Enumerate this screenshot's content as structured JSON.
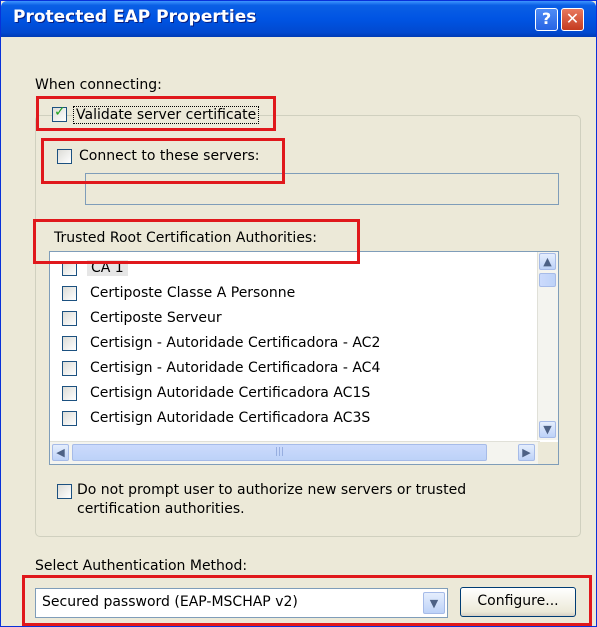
{
  "window": {
    "title": "Protected EAP Properties",
    "help_button": "?",
    "close_button": "✕"
  },
  "when_connecting_label": "When connecting:",
  "validate_server_certificate": {
    "label": "Validate server certificate",
    "checked": true
  },
  "connect_to_servers": {
    "label": "Connect to these servers:",
    "checked": false,
    "value": ""
  },
  "trusted_root_label": "Trusted Root Certification Authorities:",
  "trusted_roots": [
    {
      "label": "CA 1",
      "checked": false
    },
    {
      "label": "Certiposte Classe A Personne",
      "checked": false
    },
    {
      "label": "Certiposte Serveur",
      "checked": false
    },
    {
      "label": "Certisign - Autoridade Certificadora - AC2",
      "checked": false
    },
    {
      "label": "Certisign - Autoridade Certificadora - AC4",
      "checked": false
    },
    {
      "label": "Certisign Autoridade Certificadora AC1S",
      "checked": false
    },
    {
      "label": "Certisign Autoridade Certificadora AC3S",
      "checked": false
    }
  ],
  "do_not_prompt": {
    "line1": "Do not prompt user to authorize new servers or trusted",
    "line2": "certification authorities.",
    "checked": false
  },
  "auth_method_label": "Select Authentication Method:",
  "auth_method_value": "Secured password (EAP-MSCHAP v2)",
  "configure_button": "Configure...",
  "colors": {
    "title_bar": "#0054e3",
    "highlight_box": "#e0181c",
    "dialog_bg": "#ece9d8"
  },
  "icons": {
    "help": "help-icon",
    "close": "close-icon",
    "checkmark": "checkmark-icon",
    "dropdown": "chevron-down-icon"
  }
}
